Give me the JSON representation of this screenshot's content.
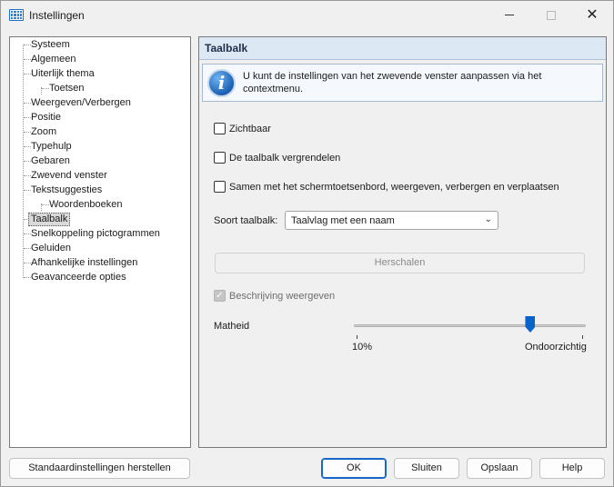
{
  "window": {
    "title": "Instellingen",
    "icon": "keyboard-icon",
    "controls": {
      "minimize": "—",
      "maximize": "□",
      "close": "✕"
    }
  },
  "tree": {
    "items": [
      {
        "label": "Systeem",
        "level": 0
      },
      {
        "label": "Algemeen",
        "level": 0
      },
      {
        "label": "Uiterlijk thema",
        "level": 0
      },
      {
        "label": "Toetsen",
        "level": 1
      },
      {
        "label": "Weergeven/Verbergen",
        "level": 0
      },
      {
        "label": "Positie",
        "level": 0
      },
      {
        "label": "Zoom",
        "level": 0
      },
      {
        "label": "Typehulp",
        "level": 0
      },
      {
        "label": "Gebaren",
        "level": 0
      },
      {
        "label": "Zwevend venster",
        "level": 0
      },
      {
        "label": "Tekstsuggesties",
        "level": 0
      },
      {
        "label": "Woordenboeken",
        "level": 1
      },
      {
        "label": "Taalbalk",
        "level": 0,
        "selected": true
      },
      {
        "label": "Snelkoppeling pictogrammen",
        "level": 0
      },
      {
        "label": "Geluiden",
        "level": 0
      },
      {
        "label": "Afhankelijke instellingen",
        "level": 0
      },
      {
        "label": "Geavanceerde opties",
        "level": 0
      }
    ]
  },
  "panel": {
    "title": "Taalbalk",
    "info": "U kunt de instellingen van het zwevende venster aanpassen via het contextmenu.",
    "checkboxes": {
      "visible": {
        "label": "Zichtbaar",
        "checked": false
      },
      "lock": {
        "label": "De taalbalk vergrendelen",
        "checked": false
      },
      "with_keyboard": {
        "label": "Samen met het schermtoetsenbord, weergeven, verbergen en verplaatsen",
        "checked": false
      },
      "show_description": {
        "label": "Beschrijving weergeven",
        "checked": true,
        "disabled": true
      }
    },
    "type": {
      "label": "Soort taalbalk:",
      "value": "Taalvlag met een naam"
    },
    "rescale_button": "Herschalen",
    "opacity": {
      "label": "Matheid",
      "min_label": "10%",
      "max_label": "Ondoorzichtig",
      "value_fraction": 0.77
    }
  },
  "footer": {
    "restore_defaults": "Standaardinstellingen herstellen",
    "ok": "OK",
    "close": "Sluiten",
    "save": "Opslaan",
    "help": "Help"
  },
  "colors": {
    "accent": "#0a63c8",
    "header_bg": "#dde8f5"
  }
}
